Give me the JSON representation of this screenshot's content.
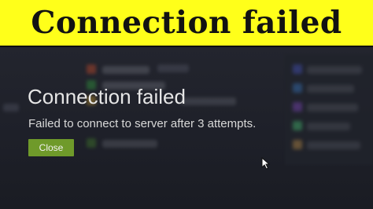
{
  "banner": {
    "text": "Connection failed"
  },
  "dialog": {
    "title": "Connection failed",
    "message": "Failed to connect to server after 3 attempts.",
    "close_label": "Close"
  },
  "colors": {
    "banner_background": "#ffff1a",
    "app_background": "#1d1f27",
    "close_button": "#6f9a2a"
  },
  "icons": [
    "mouse-pointer-icon"
  ]
}
